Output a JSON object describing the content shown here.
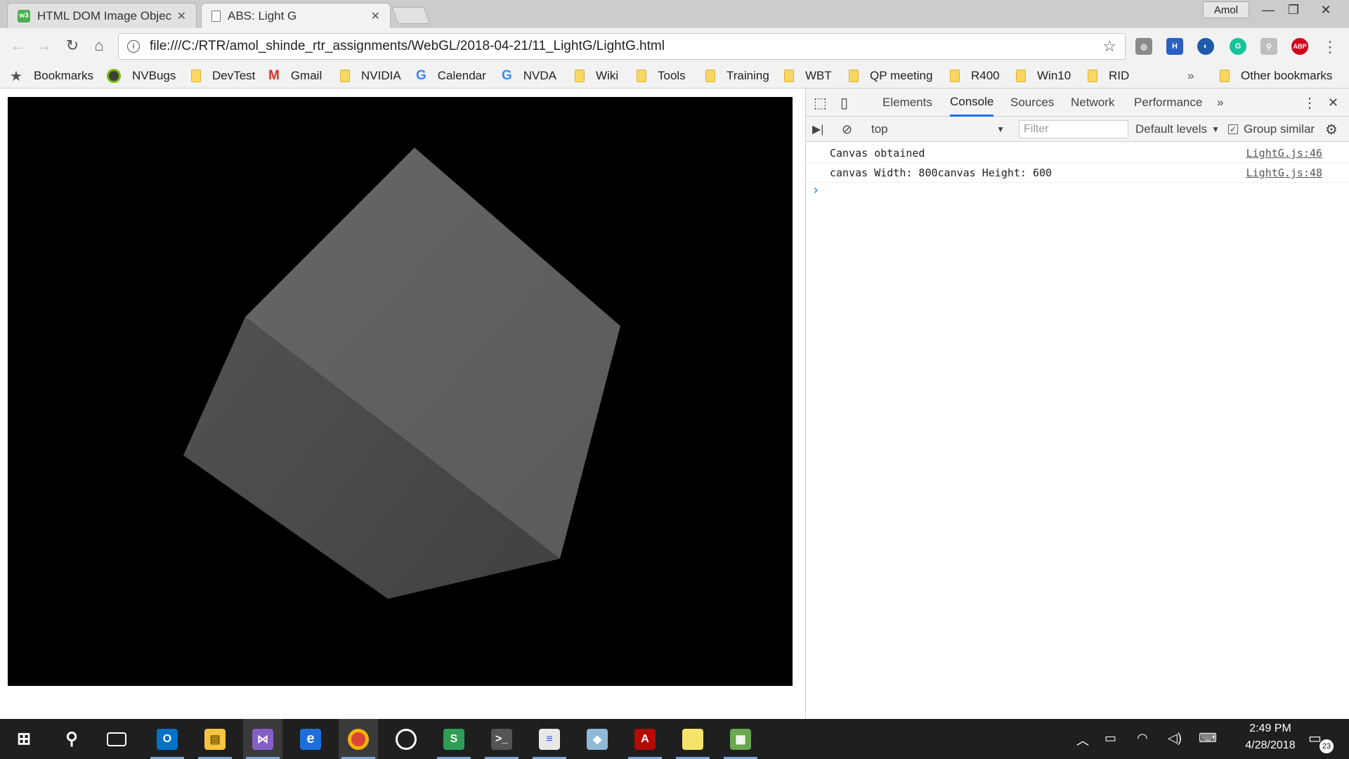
{
  "browser": {
    "tabs": [
      {
        "title": "HTML DOM Image Objec",
        "favicon": "w3",
        "active": false
      },
      {
        "title": "ABS: Light G",
        "favicon": "page-icon",
        "active": true
      }
    ],
    "profile": "Amol",
    "url": "file:///C:/RTR/amol_shinde_rtr_assignments/WebGL/2018-04-21/11_LightG/LightG.html"
  },
  "bookmarks": {
    "items": [
      "Bookmarks",
      "NVBugs",
      "DevTest",
      "Gmail",
      "NVIDIA",
      "Calendar",
      "NVDA",
      "Wiki",
      "Tools",
      "Training",
      "WBT",
      "QP meeting",
      "R400",
      "Win10",
      "RID"
    ],
    "overflow": "»",
    "other": "Other bookmarks"
  },
  "devtools": {
    "tabs": [
      "Elements",
      "Console",
      "Sources",
      "Network",
      "Performance"
    ],
    "active_tab": "Console",
    "more": "»",
    "context": "top",
    "filter_placeholder": "Filter",
    "levels": "Default levels",
    "group_similar": "Group similar",
    "logs": [
      {
        "message": "Canvas obtained",
        "source": "LightG.js:46"
      },
      {
        "message": "canvas Width: 800canvas Height: 600",
        "source": "LightG.js:48"
      }
    ],
    "prompt": "›"
  },
  "taskbar": {
    "time": "2:49 PM",
    "date": "4/28/2018",
    "notifications": "23"
  },
  "colors": {
    "cube_top": "#5e5e5e",
    "cube_front": "#4a4a4a",
    "accent": "#1a73e8"
  }
}
